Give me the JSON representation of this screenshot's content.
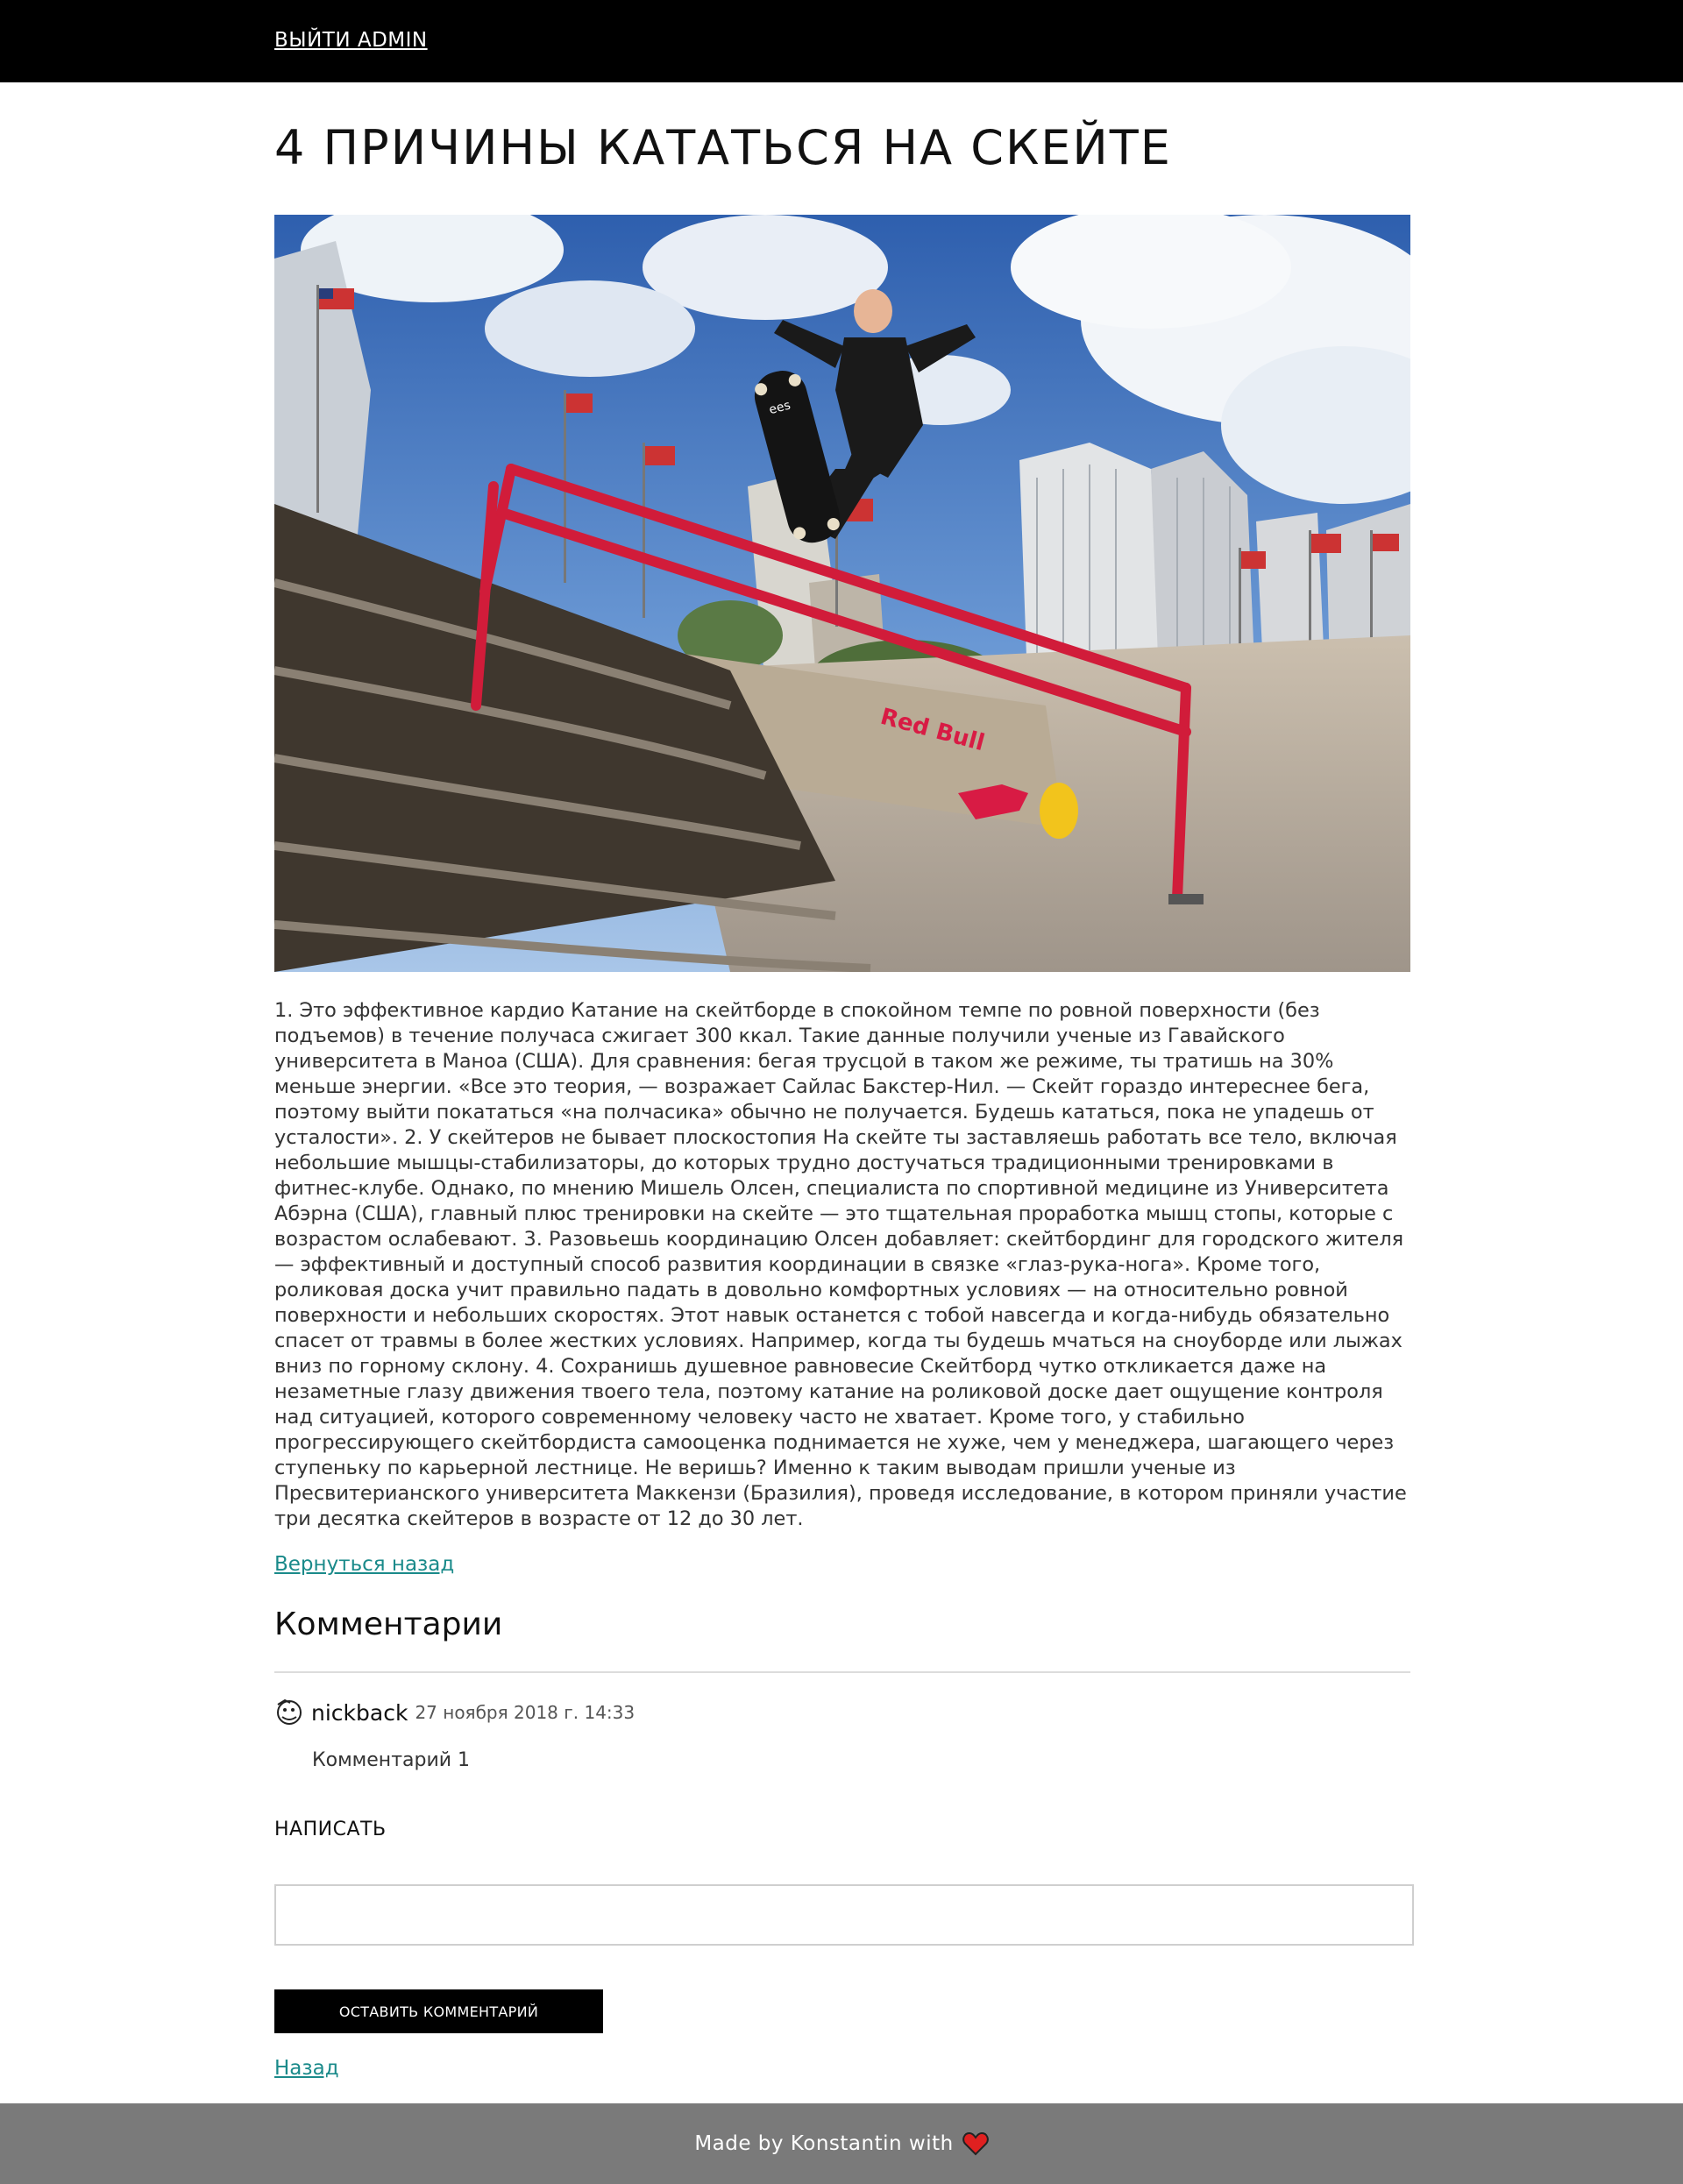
{
  "header": {
    "logout_label": "ВЫЙТИ ADMIN"
  },
  "article": {
    "title": "4 ПРИЧИНЫ КАТАТЬСЯ НА СКЕЙТЕ",
    "image_brand_text": "Red Bull",
    "body": "1. Это эффективное кардио Катание на скейтборде в спокойном темпе по ровной поверхности (без подъемов) в течение получаса сжигает 300 ккал. Такие данные получили ученые из Гавайского университета в Маноа (США). Для сравнения: бегая трусцой в таком же режиме, ты тратишь на 30% меньше энергии. «Все это теория, — возражает Сайлас Бакстер-Нил. — Скейт гораздо интереснее бега, поэтому выйти покататься «на полчасика» обычно не получается. Будешь кататься, пока не упадешь от усталости». 2. У скейтеров не бывает плоскостопия На скейте ты заставляешь работать все тело, включая небольшие мышцы-стабилизаторы, до которых трудно достучаться традиционными тренировками в фитнес-клубе. Однако, по мнению Мишель Олсен, специалиста по спортивной медицине из Университета Абэрна (США), главный плюс тренировки на скейте — это тщательная проработка мышц стопы, которые с возрастом ослабевают. 3. Разовьешь координацию Олсен добавляет: скейтбординг для городского жителя — эффективный и доступный способ развития координации в связке «глаз-рука-нога». Кроме того, роликовая доска учит правильно падать в довольно комфортных условиях — на относительно ровной поверхности и небольших скоростях. Этот навык останется с тобой навсегда и когда-нибудь обязательно спасет от травмы в более жестких условиях. Например, когда ты будешь мчаться на сноуборде или лыжах вниз по горному склону. 4. Сохранишь душевное равновесие Скейтборд чутко откликается даже на незаметные глазу движения твоего тела, поэтому катание на роликовой доске дает ощущение контроля над ситуацией, которого современному человеку часто не хватает. Кроме того, у стабильно прогрессирующего скейтбордиста самооценка поднимается не хуже, чем у менеджера, шагающего через ступеньку по карьерной лестнице. Не веришь? Именно к таким выводам пришли ученые из Пресвитерианского университета Маккензи (Бразилия), проведя исследование, в котором приняли участие три десятка скейтеров в возрасте от 12 до 30 лет.",
    "back_link": "Вернуться назад"
  },
  "comments": {
    "heading": "Комментарии",
    "items": [
      {
        "author": "nickback",
        "date": "27 ноября 2018 г. 14:33",
        "text": "Комментарий 1"
      }
    ],
    "write_label": "НАПИСАТЬ",
    "input_value": "",
    "submit_label": "ОСТАВИТЬ КОММЕНТАРИЙ",
    "nav_back": "Назад"
  },
  "footer": {
    "text": "Made by Konstantin with"
  },
  "colors": {
    "topbar": "#000000",
    "link": "#1a8a8a",
    "footer": "#7a7a7a",
    "heart": "#e02020"
  },
  "icons": {
    "avatar": "avatar-icon",
    "heart": "heart-icon"
  }
}
